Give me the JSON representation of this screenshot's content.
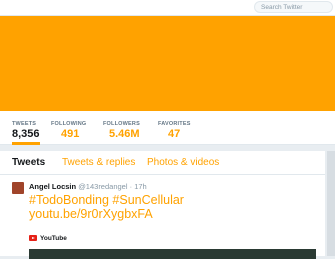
{
  "header": {
    "search_placeholder": "Search Twitter"
  },
  "banner": {
    "color": "#ffa200"
  },
  "stats": [
    {
      "label": "TWEETS",
      "value": "8,356"
    },
    {
      "label": "FOLLOWING",
      "value": "491"
    },
    {
      "label": "FOLLOWERS",
      "value": "5.46M"
    },
    {
      "label": "FAVORITES",
      "value": "47"
    }
  ],
  "tabs": [
    {
      "label": "Tweets"
    },
    {
      "label": "Tweets & replies"
    },
    {
      "label": "Photos & videos"
    }
  ],
  "tweet": {
    "name": "Angel Locsin",
    "handle": "@143redangel",
    "time": "· 17h",
    "text_line1": "#TodoBonding #SunCellular",
    "text_line2": "youtu.be/9r0rXygbxFA",
    "card_source": "YouTube"
  },
  "colors": {
    "accent": "#ffa200",
    "text": "#14171a",
    "muted": "#657786"
  }
}
